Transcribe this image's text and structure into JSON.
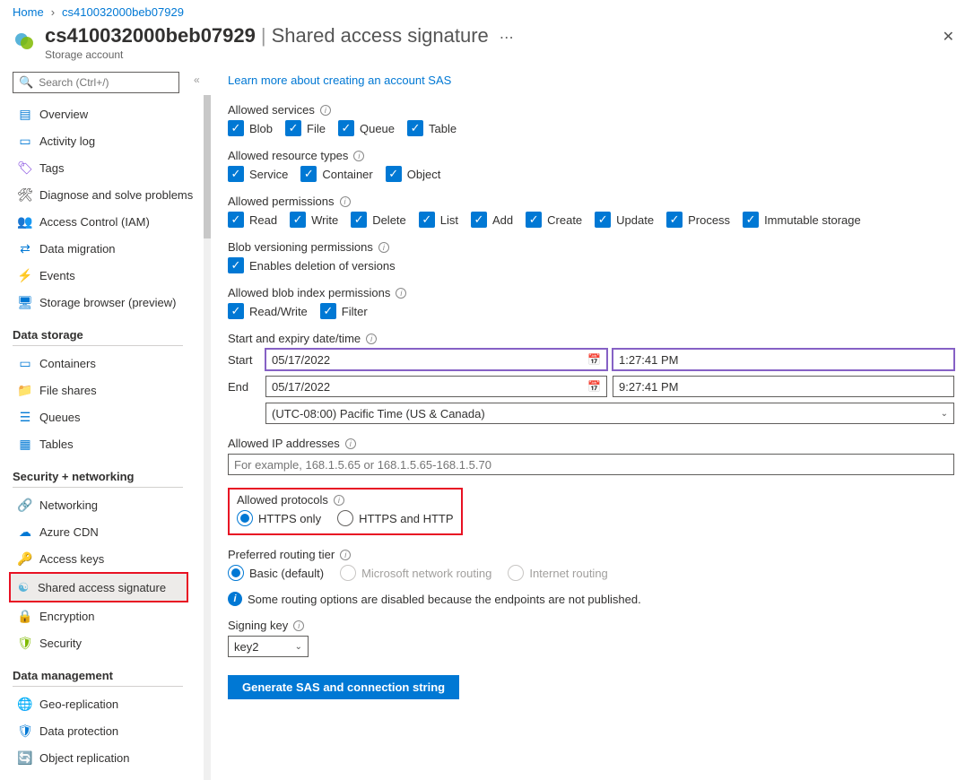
{
  "breadcrumb": {
    "home": "Home",
    "current": "cs410032000beb07929"
  },
  "header": {
    "title": "cs410032000beb07929",
    "section": "Shared access signature",
    "subtitle": "Storage account"
  },
  "search": {
    "placeholder": "Search (Ctrl+/)"
  },
  "nav": {
    "overview": "Overview",
    "activity": "Activity log",
    "tags": "Tags",
    "diagnose": "Diagnose and solve problems",
    "access": "Access Control (IAM)",
    "migration": "Data migration",
    "events": "Events",
    "browser": "Storage browser (preview)"
  },
  "nav_sections": {
    "storage": "Data storage",
    "security": "Security + networking",
    "management": "Data management"
  },
  "nav_storage": {
    "containers": "Containers",
    "fileshares": "File shares",
    "queues": "Queues",
    "tables": "Tables"
  },
  "nav_security": {
    "networking": "Networking",
    "cdn": "Azure CDN",
    "keys": "Access keys",
    "sas": "Shared access signature",
    "encryption": "Encryption",
    "security": "Security"
  },
  "nav_mgmt": {
    "geo": "Geo-replication",
    "protection": "Data protection",
    "object": "Object replication"
  },
  "main": {
    "learn_link": "Learn more about creating an account SAS",
    "services_label": "Allowed services",
    "services": {
      "blob": "Blob",
      "file": "File",
      "queue": "Queue",
      "table": "Table"
    },
    "restypes_label": "Allowed resource types",
    "restypes": {
      "service": "Service",
      "container": "Container",
      "object": "Object"
    },
    "perms_label": "Allowed permissions",
    "perms": {
      "read": "Read",
      "write": "Write",
      "delete": "Delete",
      "list": "List",
      "add": "Add",
      "create": "Create",
      "update": "Update",
      "process": "Process",
      "immutable": "Immutable storage"
    },
    "blobver_label": "Blob versioning permissions",
    "blobver": {
      "enable": "Enables deletion of versions"
    },
    "blobidx_label": "Allowed blob index permissions",
    "blobidx": {
      "rw": "Read/Write",
      "filter": "Filter"
    },
    "datetime_label": "Start and expiry date/time",
    "start_label": "Start",
    "end_label": "End",
    "start_date": "05/17/2022",
    "start_time": "1:27:41 PM",
    "end_date": "05/17/2022",
    "end_time": "9:27:41 PM",
    "timezone": "(UTC-08:00) Pacific Time (US & Canada)",
    "ip_label": "Allowed IP addresses",
    "ip_placeholder": "For example, 168.1.5.65 or 168.1.5.65-168.1.5.70",
    "proto_label": "Allowed protocols",
    "proto": {
      "https": "HTTPS only",
      "both": "HTTPS and HTTP"
    },
    "routing_label": "Preferred routing tier",
    "routing": {
      "basic": "Basic (default)",
      "ms": "Microsoft network routing",
      "internet": "Internet routing"
    },
    "routing_info": "Some routing options are disabled because the endpoints are not published.",
    "signing_label": "Signing key",
    "signing_value": "key2",
    "generate": "Generate SAS and connection string"
  }
}
